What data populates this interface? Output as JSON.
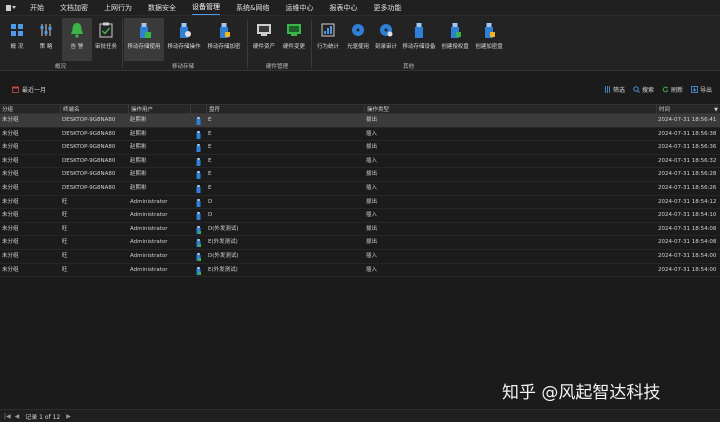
{
  "menubar": {
    "items": [
      "开始",
      "文档加密",
      "上网行为",
      "数据安全",
      "设备管理",
      "系统&网络",
      "运维中心",
      "报表中心",
      "更多功能"
    ],
    "active_index": 4
  },
  "ribbon": {
    "buttons": [
      {
        "label": "概 况",
        "icon": "overview-icon"
      },
      {
        "label": "策 略",
        "icon": "policy-icon"
      },
      {
        "label": "告 警",
        "icon": "alarm-bell-icon"
      },
      {
        "label": "审批任务",
        "icon": "approval-task-icon"
      },
      {
        "label": "移动存储使用",
        "icon": "usb-usage-icon"
      },
      {
        "label": "移动存储操作",
        "icon": "usb-operation-icon"
      },
      {
        "label": "移动存储加密",
        "icon": "usb-encrypt-icon"
      },
      {
        "label": "硬件资产",
        "icon": "hardware-asset-icon"
      },
      {
        "label": "硬件变更",
        "icon": "hardware-change-icon"
      },
      {
        "label": "行为统计",
        "icon": "behavior-stats-icon"
      },
      {
        "label": "光驱使用",
        "icon": "cd-drive-icon"
      },
      {
        "label": "刻录审计",
        "icon": "burn-audit-icon"
      },
      {
        "label": "移动存储设备",
        "icon": "usb-device-icon"
      },
      {
        "label": "创建授权盘",
        "icon": "create-auth-disk-icon"
      },
      {
        "label": "创建加密盘",
        "icon": "create-encrypted-disk-icon"
      }
    ],
    "groups": [
      "概况",
      "移动存储",
      "硬件管理",
      "其他"
    ]
  },
  "toolbar": {
    "date_filter": "最近一月",
    "filter_label": "筛选",
    "search_label": "搜索",
    "refresh_label": "刷新",
    "export_label": "导出"
  },
  "table": {
    "columns": [
      "分组",
      "终端名",
      "操作用户",
      "盘符",
      "操作类型",
      "时间"
    ],
    "rows": [
      {
        "group": "未分组",
        "terminal": "DESKTOP-9G8NA80",
        "user": "赵熙彬",
        "drive": "E",
        "op": "拔出",
        "time": "2024-07-31 18:56:41"
      },
      {
        "group": "未分组",
        "terminal": "DESKTOP-9G8NA80",
        "user": "赵熙彬",
        "drive": "E",
        "op": "插入",
        "time": "2024-07-31 18:56:38"
      },
      {
        "group": "未分组",
        "terminal": "DESKTOP-9G8NA80",
        "user": "赵熙彬",
        "drive": "E",
        "op": "拔出",
        "time": "2024-07-31 18:56:36"
      },
      {
        "group": "未分组",
        "terminal": "DESKTOP-9G8NA80",
        "user": "赵熙彬",
        "drive": "E",
        "op": "插入",
        "time": "2024-07-31 18:56:32"
      },
      {
        "group": "未分组",
        "terminal": "DESKTOP-9G8NA80",
        "user": "赵熙彬",
        "drive": "E",
        "op": "拔出",
        "time": "2024-07-31 18:56:28"
      },
      {
        "group": "未分组",
        "terminal": "DESKTOP-9G8NA80",
        "user": "赵熙彬",
        "drive": "E",
        "op": "插入",
        "time": "2024-07-31 18:56:26"
      },
      {
        "group": "未分组",
        "terminal": "旺",
        "user": "Administrator",
        "drive": "D",
        "op": "拔出",
        "time": "2024-07-31 18:54:12"
      },
      {
        "group": "未分组",
        "terminal": "旺",
        "user": "Administrator",
        "drive": "D",
        "op": "插入",
        "time": "2024-07-31 18:54:10"
      },
      {
        "group": "未分组",
        "terminal": "旺",
        "user": "Administrator",
        "drive": "D(外发测试)",
        "op": "拔出",
        "time": "2024-07-31 18:54:08"
      },
      {
        "group": "未分组",
        "terminal": "旺",
        "user": "Administrator",
        "drive": "E(外发测试)",
        "op": "拔出",
        "time": "2024-07-31 18:54:08"
      },
      {
        "group": "未分组",
        "terminal": "旺",
        "user": "Administrator",
        "drive": "D(外发测试)",
        "op": "插入",
        "time": "2024-07-31 18:54:00"
      },
      {
        "group": "未分组",
        "terminal": "旺",
        "user": "Administrator",
        "drive": "E(外发测试)",
        "op": "插入",
        "time": "2024-07-31 18:54:00"
      }
    ],
    "selected_row": 0
  },
  "statusbar": {
    "record_text": "记录 1 of 12"
  },
  "watermark": "知乎 @风起智达科技",
  "colors": {
    "accent": "#4f9be8",
    "usb_blue": "#2f7fd6",
    "alarm_green": "#3bb54a"
  }
}
